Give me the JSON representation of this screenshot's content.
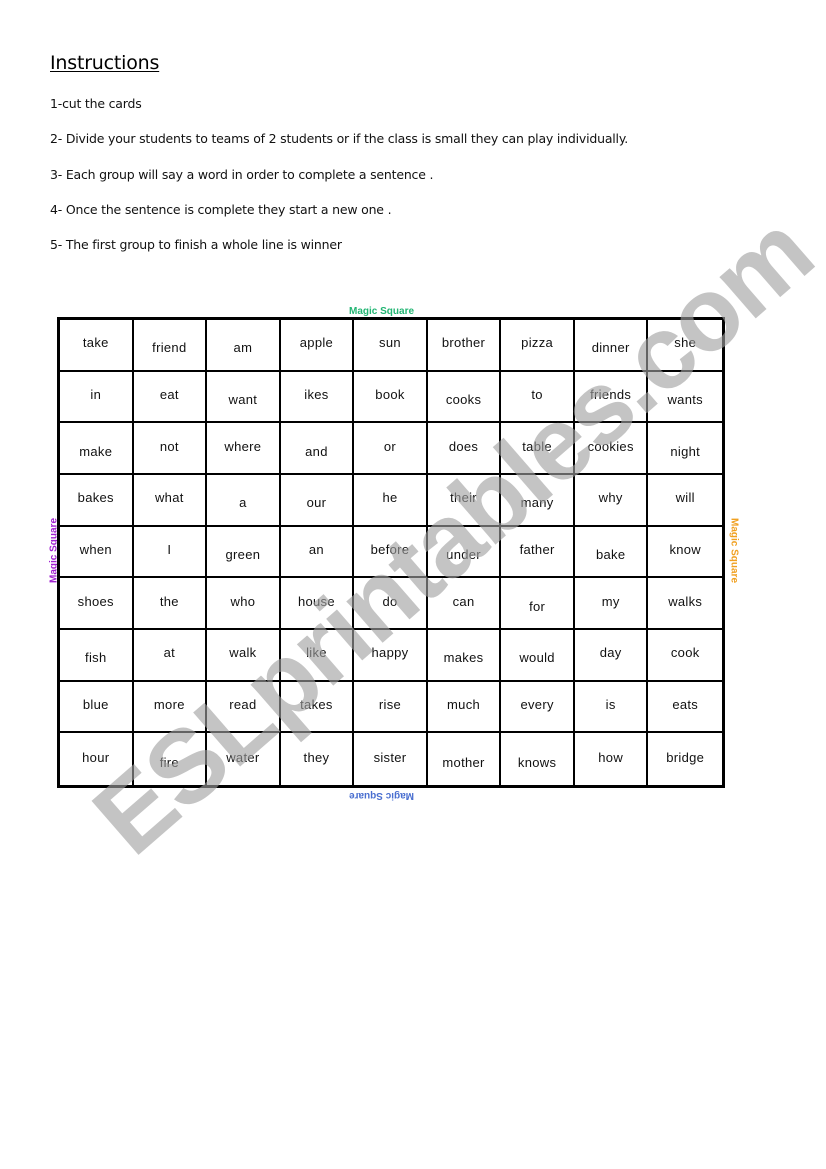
{
  "instructions": {
    "heading": "Instructions",
    "steps": [
      "1-cut the cards",
      "2- Divide your students to teams of 2 students or if the class is small they can play individually.",
      "3- Each group will say a word in order to complete a sentence .",
      "4- Once the sentence is complete they start a new one .",
      "5- The first group to finish a whole line is winner"
    ]
  },
  "magic_square": {
    "labels": {
      "top": "Magic Square",
      "bottom": "Magic Square",
      "left": "Magic Square",
      "right": "Magic Square"
    },
    "label_colors": {
      "top": "#22b573",
      "bottom": "#4a6fd0",
      "left": "#a020d0",
      "right": "#f0a020"
    },
    "rows": [
      [
        "take",
        "friend",
        "am",
        "apple",
        "sun",
        "brother",
        "pizza",
        "dinner",
        "she"
      ],
      [
        "in",
        "eat",
        "want",
        "ikes",
        "book",
        "cooks",
        "to",
        "friends",
        "wants"
      ],
      [
        "make",
        "not",
        "where",
        "and",
        "or",
        "does",
        "table",
        "cookies",
        "night"
      ],
      [
        "bakes",
        "what",
        "a",
        "our",
        "he",
        "their",
        "many",
        "why",
        "will"
      ],
      [
        "when",
        "I",
        "green",
        "an",
        "before",
        "under",
        "father",
        "bake",
        "know"
      ],
      [
        "shoes",
        "the",
        "who",
        "house",
        "do",
        "can",
        "for",
        "my",
        "walks"
      ],
      [
        "fish",
        "at",
        "walk",
        "like",
        "happy",
        "makes",
        "would",
        "day",
        "cook"
      ],
      [
        "blue",
        "more",
        "read",
        "takes",
        "rise",
        "much",
        "every",
        "is",
        "eats"
      ],
      [
        "hour",
        "fire",
        "water",
        "they",
        "sister",
        "mother",
        "knows",
        "how",
        "bridge"
      ]
    ]
  },
  "watermark": {
    "text": "ESLprintables.com",
    "color": "#c0c0c0"
  }
}
